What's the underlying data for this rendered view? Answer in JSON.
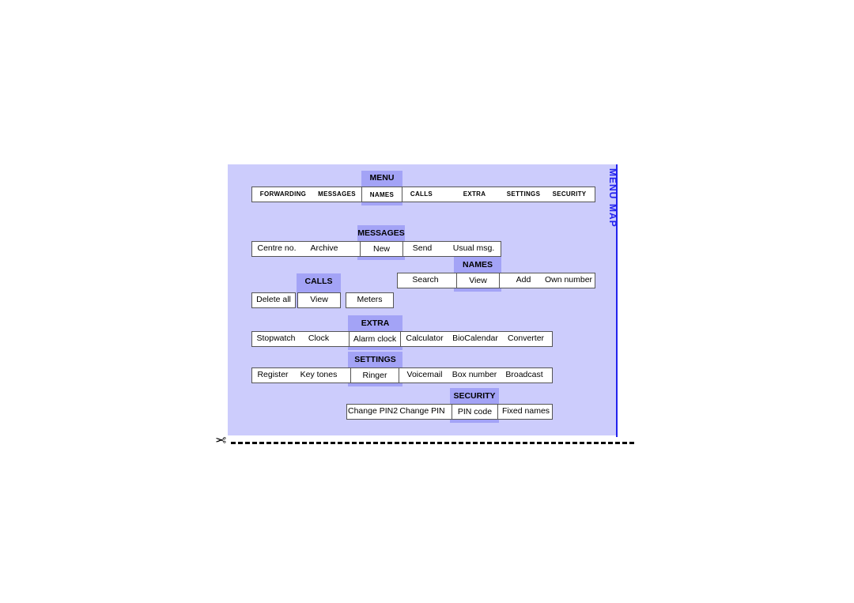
{
  "page": {
    "title": "MENU MAP",
    "colors": {
      "panel_bg": "#ccccfc",
      "highlight": "#a3a3f6",
      "rule": "#2222ee",
      "box_border": "#555555",
      "box_bg": "#ffffff"
    }
  },
  "rows": [
    {
      "caption": "MENU",
      "style": "smallcaps",
      "items": [
        {
          "label": "Forwarding",
          "selected": false
        },
        {
          "label": "Messages",
          "selected": false
        },
        {
          "label": "Names",
          "selected": true
        },
        {
          "label": "Calls",
          "selected": false
        },
        {
          "label": "Extra",
          "selected": false
        },
        {
          "label": "Settings",
          "selected": false
        },
        {
          "label": "Security",
          "selected": false
        }
      ]
    },
    {
      "caption": "MESSAGES",
      "style": "normal",
      "items": [
        {
          "label": "Centre no.",
          "selected": false
        },
        {
          "label": "Archive",
          "selected": false
        },
        {
          "label": "New",
          "selected": true
        },
        {
          "label": "Send",
          "selected": false
        },
        {
          "label": "Usual msg.",
          "selected": false
        }
      ]
    },
    {
      "caption": "NAMES",
      "style": "normal",
      "items": [
        {
          "label": "Search",
          "selected": false
        },
        {
          "label": "View",
          "selected": true
        },
        {
          "label": "Add",
          "selected": false
        },
        {
          "label": "Own number",
          "selected": false
        }
      ]
    },
    {
      "caption": "CALLS",
      "style": "normal",
      "items": [
        {
          "label": "Delete all",
          "selected": false
        },
        {
          "label": "View",
          "selected": true
        },
        {
          "label": "Meters",
          "selected": false
        }
      ]
    },
    {
      "caption": "EXTRA",
      "style": "normal",
      "items": [
        {
          "label": "Stopwatch",
          "selected": false
        },
        {
          "label": "Clock",
          "selected": false
        },
        {
          "label": "Alarm clock",
          "selected": true
        },
        {
          "label": "Calculator",
          "selected": false
        },
        {
          "label": "BioCalendar",
          "selected": false
        },
        {
          "label": "Converter",
          "selected": false
        }
      ]
    },
    {
      "caption": "SETTINGS",
      "style": "normal",
      "items": [
        {
          "label": "Register",
          "selected": false
        },
        {
          "label": "Key tones",
          "selected": false
        },
        {
          "label": "Ringer",
          "selected": true
        },
        {
          "label": "Voicemail",
          "selected": false
        },
        {
          "label": "Box number",
          "selected": false
        },
        {
          "label": "Broadcast",
          "selected": false
        }
      ]
    },
    {
      "caption": "SECURITY",
      "style": "normal",
      "items": [
        {
          "label": "Change PIN2",
          "selected": false
        },
        {
          "label": "Change PIN",
          "selected": false
        },
        {
          "label": "PIN code",
          "selected": true
        },
        {
          "label": "Fixed names",
          "selected": false
        }
      ]
    }
  ],
  "cut": {
    "scissors_icon": "scissors-icon",
    "icon_glyph": "✂"
  }
}
